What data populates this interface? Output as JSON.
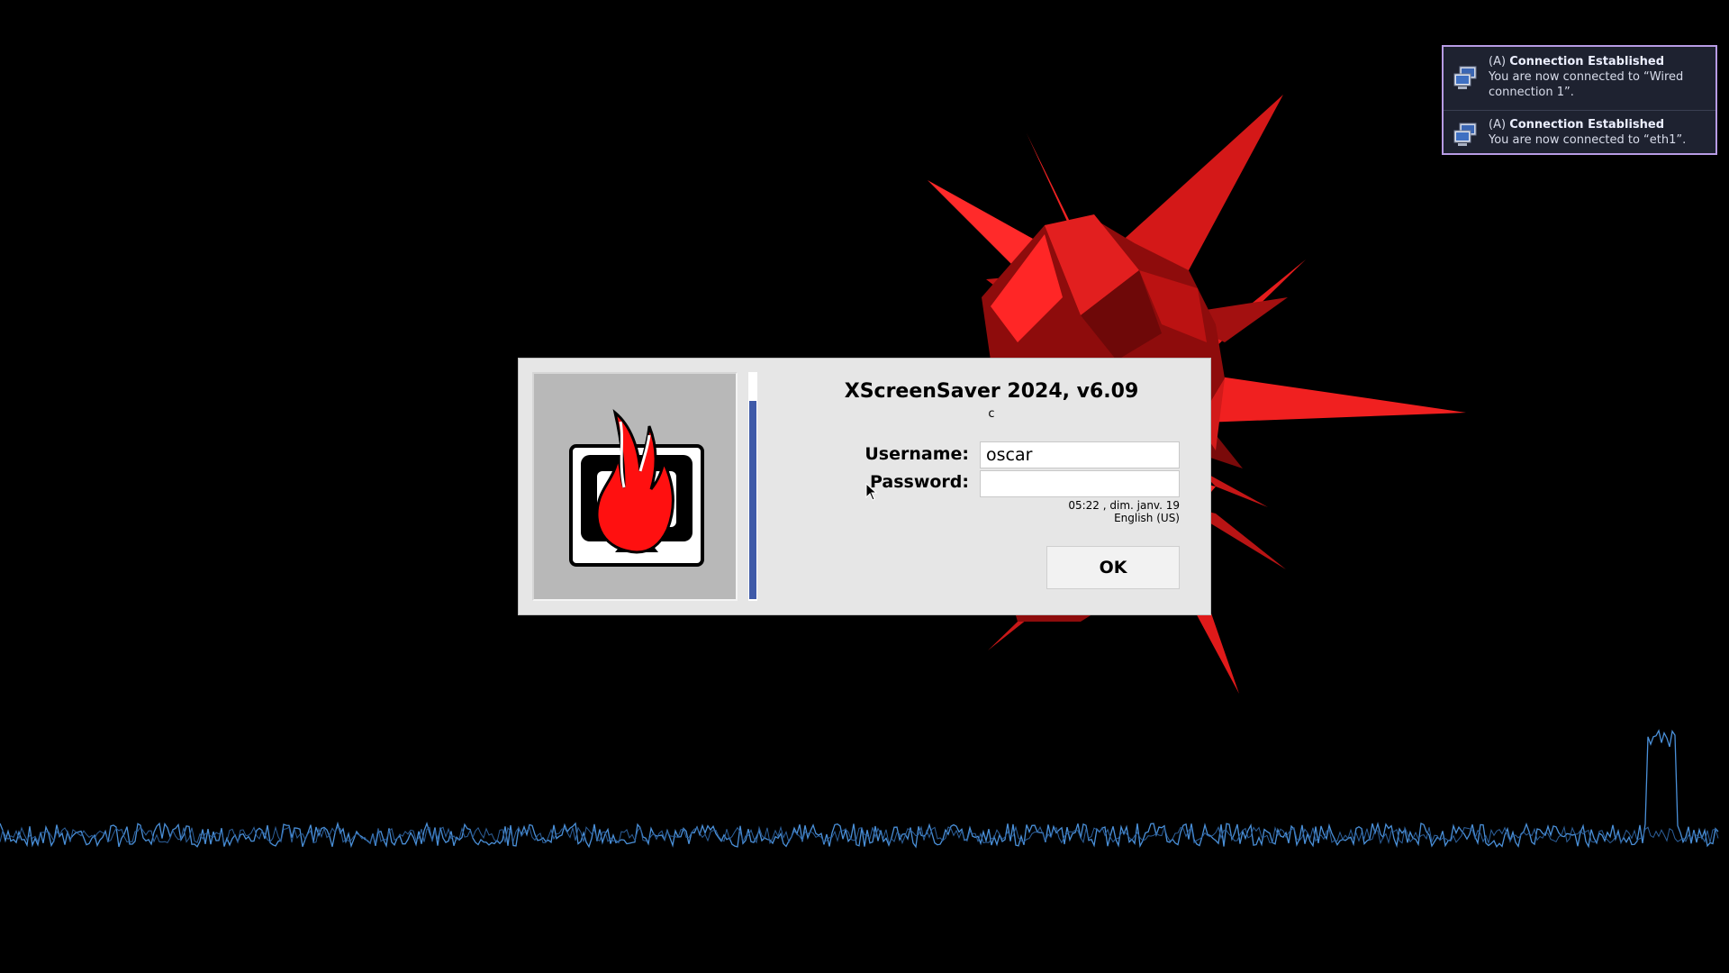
{
  "notifications": [
    {
      "prefix": "(A)",
      "title": "Connection Established",
      "body": "You are now connected to “Wired connection 1”.",
      "icon": "network-computers-icon"
    },
    {
      "prefix": "(A)",
      "title": "Connection Established",
      "body": "You are now connected to “eth1”.",
      "icon": "network-computers-icon"
    }
  ],
  "dialog": {
    "title": "XScreenSaver 2024, v6.09",
    "subtitle": "c",
    "username_label": "Username:",
    "username_value": "oscar",
    "password_label": "Password:",
    "password_value": "",
    "datetime": "05:22 , dim. janv. 19",
    "keyboard_layout": "English (US)",
    "ok_label": "OK",
    "logo_icon": "xscreensaver-flame-monitor-icon",
    "unlock_timer_fraction": 0.88
  },
  "colors": {
    "notification_border": "#b79be4",
    "notification_bg": "#1e2230",
    "progress_fill": "#3f5aa8",
    "dialog_bg": "#e6e6e6",
    "star_red": "#e81c1c",
    "waveform_blue": "#4a90d9"
  }
}
